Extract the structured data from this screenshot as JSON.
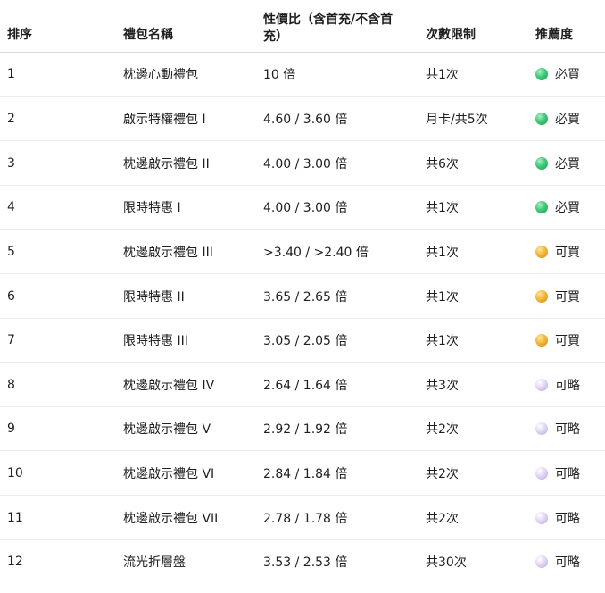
{
  "header": {
    "rank": "排序",
    "name": "禮包名稱",
    "ratio": "性價比（含首充/不含首充）",
    "limit": "次數限制",
    "recommend": "推薦度"
  },
  "rows": [
    {
      "rank": "1",
      "name": "枕邊心動禮包",
      "ratio": "10 倍",
      "limit": "共1次",
      "dot": "green",
      "recommend": "必買"
    },
    {
      "rank": "2",
      "name": "啟示特權禮包 I",
      "ratio": "4.60 / 3.60 倍",
      "limit": "月卡/共5次",
      "dot": "green",
      "recommend": "必買"
    },
    {
      "rank": "3",
      "name": "枕邊啟示禮包 II",
      "ratio": "4.00 / 3.00 倍",
      "limit": "共6次",
      "dot": "green",
      "recommend": "必買"
    },
    {
      "rank": "4",
      "name": "限時特惠 I",
      "ratio": "4.00 / 3.00 倍",
      "limit": "共1次",
      "dot": "green",
      "recommend": "必買"
    },
    {
      "rank": "5",
      "name": "枕邊啟示禮包 III",
      "ratio": ">3.40 / >2.40 倍",
      "limit": "共1次",
      "dot": "yellow",
      "recommend": "可買"
    },
    {
      "rank": "6",
      "name": "限時特惠 II",
      "ratio": "3.65 / 2.65 倍",
      "limit": "共1次",
      "dot": "yellow",
      "recommend": "可買"
    },
    {
      "rank": "7",
      "name": "限時特惠 III",
      "ratio": "3.05 / 2.05 倍",
      "limit": "共1次",
      "dot": "yellow",
      "recommend": "可買"
    },
    {
      "rank": "8",
      "name": "枕邊啟示禮包 IV",
      "ratio": "2.64 / 1.64 倍",
      "limit": "共3次",
      "dot": "lavender",
      "recommend": "可略"
    },
    {
      "rank": "9",
      "name": "枕邊啟示禮包 V",
      "ratio": "2.92 / 1.92 倍",
      "limit": "共2次",
      "dot": "lavender",
      "recommend": "可略"
    },
    {
      "rank": "10",
      "name": "枕邊啟示禮包 VI",
      "ratio": "2.84 / 1.84 倍",
      "limit": "共2次",
      "dot": "lavender",
      "recommend": "可略"
    },
    {
      "rank": "11",
      "name": "枕邊啟示禮包 VII",
      "ratio": "2.78 / 1.78 倍",
      "limit": "共2次",
      "dot": "lavender",
      "recommend": "可略"
    },
    {
      "rank": "12",
      "name": "流光折層盤",
      "ratio": "3.53 / 2.53 倍",
      "limit": "共30次",
      "dot": "lavender",
      "recommend": "可略"
    }
  ],
  "dot_colors": {
    "green": "#3fca78",
    "yellow": "#f2b83a",
    "lavender": "#e2d6f5"
  }
}
